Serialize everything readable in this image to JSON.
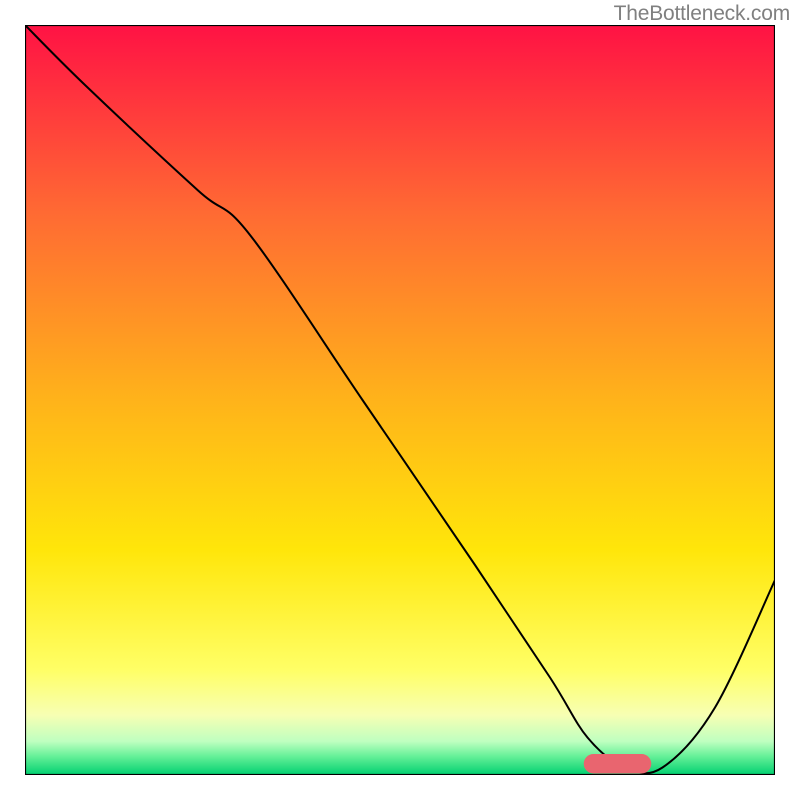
{
  "attribution": "TheBottleneck.com",
  "chart_data": {
    "type": "line",
    "title": "",
    "xlabel": "",
    "ylabel": "",
    "xlim": [
      0,
      100
    ],
    "ylim": [
      0,
      100
    ],
    "background": {
      "kind": "vertical-gradient",
      "stops": [
        {
          "t": 0.0,
          "color": "#ff1244"
        },
        {
          "t": 0.25,
          "color": "#ff6a33"
        },
        {
          "t": 0.5,
          "color": "#ffb31a"
        },
        {
          "t": 0.7,
          "color": "#ffe60a"
        },
        {
          "t": 0.86,
          "color": "#ffff66"
        },
        {
          "t": 0.92,
          "color": "#f7ffb3"
        },
        {
          "t": 0.955,
          "color": "#bfffc0"
        },
        {
          "t": 0.975,
          "color": "#66f098"
        },
        {
          "t": 1.0,
          "color": "#00d070"
        }
      ]
    },
    "series": [
      {
        "name": "curve",
        "color": "#000000",
        "stroke_width": 2,
        "x": [
          0,
          8,
          23,
          30,
          45,
          60,
          70,
          75,
          80,
          85,
          92,
          100
        ],
        "y": [
          100,
          92,
          78,
          72,
          50,
          28,
          13,
          5,
          1,
          1,
          9,
          26
        ]
      }
    ],
    "marker": {
      "name": "min-region",
      "shape": "capsule",
      "x_center": 79,
      "y_center": 1.5,
      "width": 9,
      "height": 2.6,
      "fill": "#e9656f"
    }
  }
}
